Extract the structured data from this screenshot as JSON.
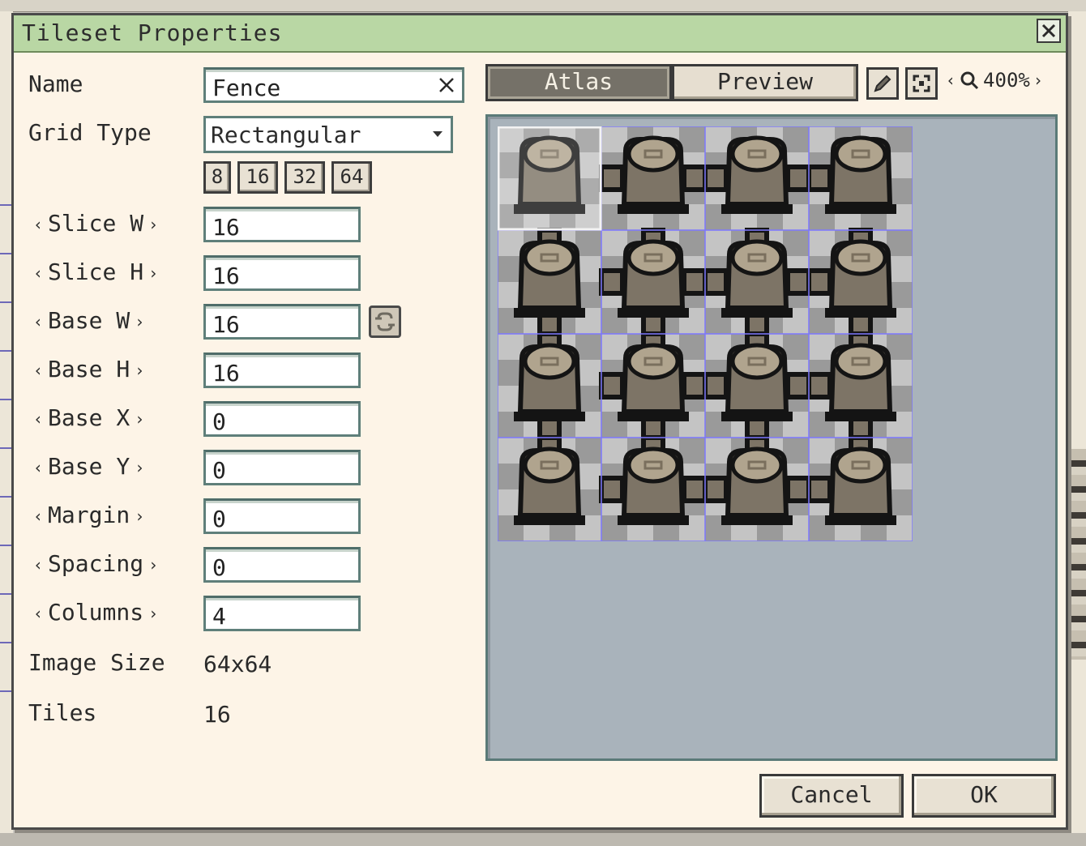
{
  "dialog": {
    "title": "Tileset Properties",
    "close_icon": "close-icon"
  },
  "form": {
    "name_label": "Name",
    "name_value": "Fence",
    "grid_type_label": "Grid Type",
    "grid_type_value": "Rectangular",
    "presets": [
      "8",
      "16",
      "32",
      "64"
    ],
    "slice_w": {
      "label": "Slice W",
      "value": "16"
    },
    "slice_h": {
      "label": "Slice H",
      "value": "16"
    },
    "base_w": {
      "label": "Base W",
      "value": "16"
    },
    "base_h": {
      "label": "Base H",
      "value": "16"
    },
    "base_x": {
      "label": "Base X",
      "value": "0"
    },
    "base_y": {
      "label": "Base Y",
      "value": "0"
    },
    "margin": {
      "label": "Margin",
      "value": "0"
    },
    "spacing": {
      "label": "Spacing",
      "value": "0"
    },
    "columns": {
      "label": "Columns",
      "value": "4"
    },
    "image_size_label": "Image Size",
    "image_size_value": "64x64",
    "tiles_label": "Tiles",
    "tiles_value": "16"
  },
  "view": {
    "tab_atlas": "Atlas",
    "tab_preview": "Preview",
    "active_tab": "Atlas",
    "zoom_value": "400%",
    "tools": [
      "pencil-icon",
      "fit-view-icon",
      "zoom-icon"
    ]
  },
  "atlas": {
    "columns": 4,
    "rows": 4,
    "selected_tile": 0,
    "colors": {
      "checker_light": "#c4c4c4",
      "checker_dark": "#9a9a9a",
      "post_body": "#7d7466",
      "post_top": "#b0a48e",
      "outline": "#141414",
      "grid_line": "#7d77ff"
    }
  },
  "buttons": {
    "cancel": "Cancel",
    "ok": "OK"
  },
  "colors": {
    "dialog_bg": "#fdf4e7",
    "titlebar_bg": "#b9d7a4",
    "atlas_bg": "#a9b3bb"
  }
}
